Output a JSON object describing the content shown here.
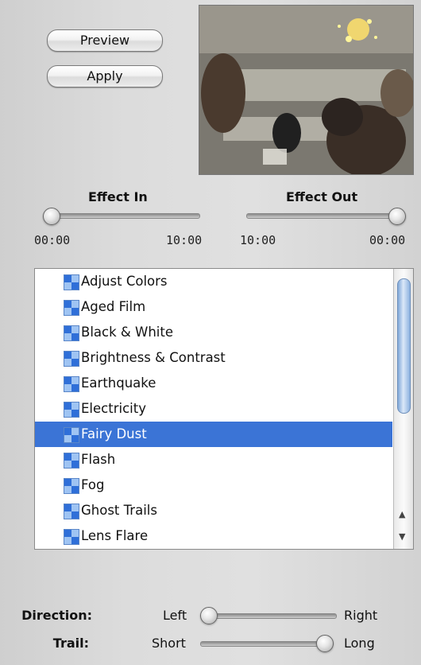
{
  "buttons": {
    "preview_label": "Preview",
    "apply_label": "Apply"
  },
  "effect_in": {
    "heading": "Effect In",
    "start_time": "00:00",
    "end_time": "10:00",
    "value": 0.0
  },
  "effect_out": {
    "heading": "Effect Out",
    "start_time": "10:00",
    "end_time": "00:00",
    "value": 1.0
  },
  "effects": {
    "selected": "Fairy Dust",
    "items": [
      "Adjust Colors",
      "Aged Film",
      "Black & White",
      "Brightness & Contrast",
      "Earthquake",
      "Electricity",
      "Fairy Dust",
      "Flash",
      "Fog",
      "Ghost Trails",
      "Lens Flare"
    ]
  },
  "direction": {
    "label": "Direction:",
    "min_label": "Left",
    "max_label": "Right",
    "value": 0.0
  },
  "trail": {
    "label": "Trail:",
    "min_label": "Short",
    "max_label": "Long",
    "value": 1.0
  },
  "colors": {
    "selection": "#3b74d6",
    "icon": "#2f6fd8"
  },
  "icons": {
    "effect": "effect-checker-icon",
    "scroll_up": "scroll-up-arrow-icon",
    "scroll_down": "scroll-down-arrow-icon"
  }
}
